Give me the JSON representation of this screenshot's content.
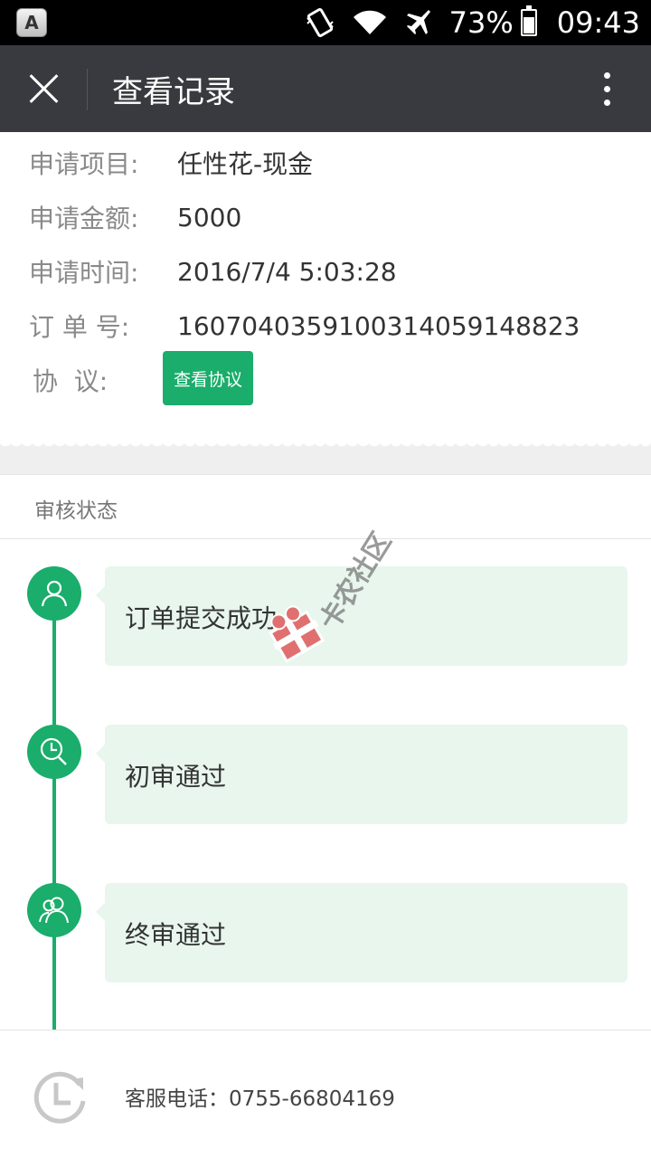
{
  "status_bar": {
    "app_icon_letter": "A",
    "battery": "73%",
    "time": "09:43"
  },
  "title_bar": {
    "title": "查看记录"
  },
  "info": {
    "rows": [
      {
        "label": "申请项目:",
        "value": "任性花-现金"
      },
      {
        "label": "申请金额:",
        "value": "5000"
      },
      {
        "label": "申请时间:",
        "value": "2016/7/4 5:03:28"
      },
      {
        "label": "订 单 号:",
        "value": "16070403591003140591488​23"
      }
    ],
    "agreement_label": "协  议:",
    "agreement_button": "查看协议"
  },
  "status_section": {
    "header": "审核状态",
    "steps": [
      {
        "icon": "user-icon",
        "label": "订单提交成功"
      },
      {
        "icon": "clock-search-icon",
        "label": "初审通过"
      },
      {
        "icon": "users-icon",
        "label": "终审通过"
      }
    ]
  },
  "footer": {
    "icon": "history-icon",
    "service_phone": "客服电话：0755-66804169"
  },
  "watermark": {
    "text": "卡农社区"
  },
  "colors": {
    "accent": "#1aad6b",
    "titlebar": "#393a3f",
    "card": "#e8f6ed"
  }
}
